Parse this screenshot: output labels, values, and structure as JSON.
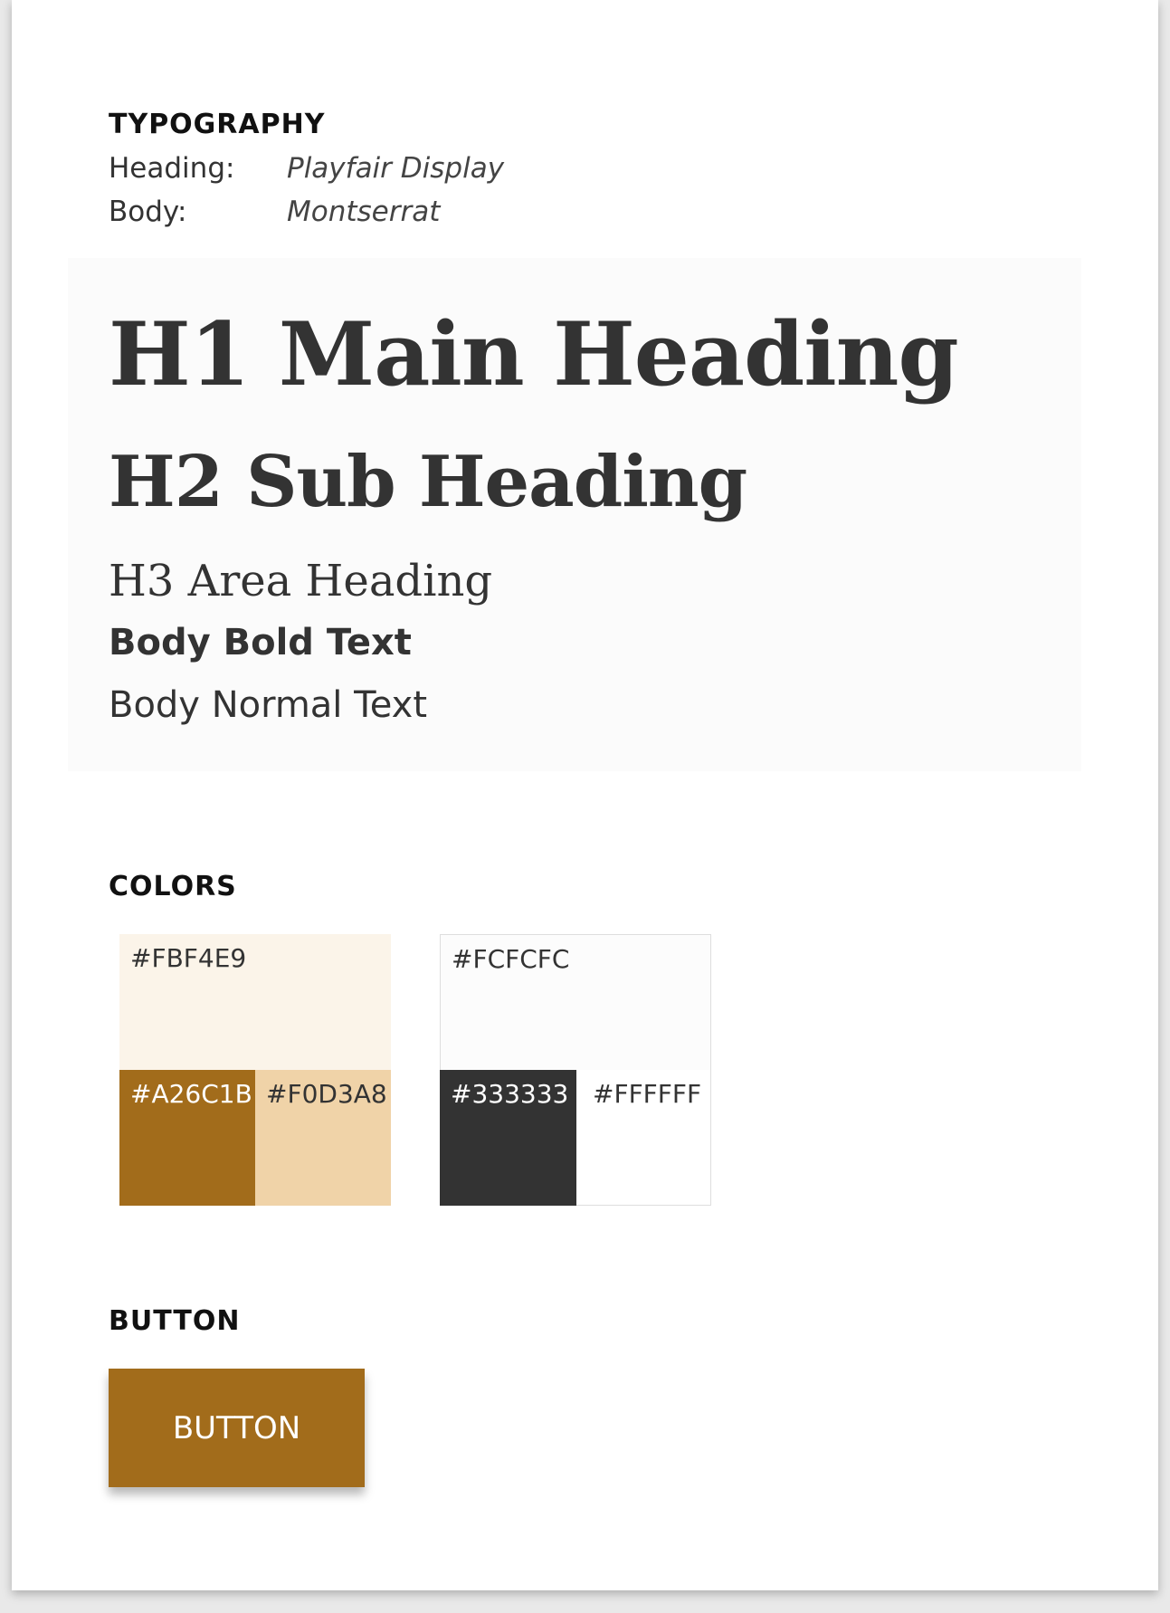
{
  "typography": {
    "title": "TYPOGRAPHY",
    "heading_label": "Heading:",
    "heading_font": "Playfair Display",
    "body_label": "Body:",
    "body_font": "Montserrat",
    "samples": {
      "h1": "H1 Main Heading",
      "h2": "H2 Sub Heading",
      "h3": "H3 Area Heading",
      "body_bold": "Body Bold Text",
      "body_normal": "Body Normal Text"
    }
  },
  "colors": {
    "title": "COLORS",
    "palette_warm": {
      "main": "#FBF4E9",
      "accent_dark": "#A26C1B",
      "accent_light": "#F0D3A8"
    },
    "palette_neutral": {
      "main": "#FCFCFC",
      "text": "#333333",
      "white": "#FFFFFF"
    }
  },
  "button": {
    "title": "BUTTON",
    "label": "BUTTON",
    "color": "#A26C1B"
  }
}
